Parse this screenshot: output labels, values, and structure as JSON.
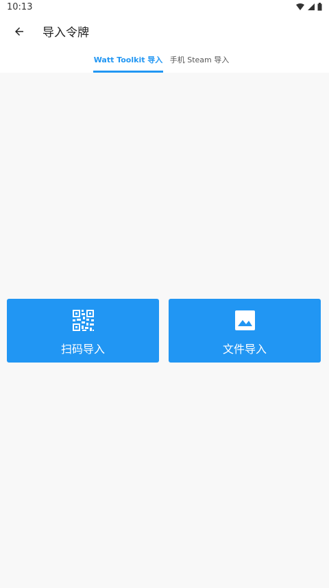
{
  "status": {
    "time": "10:13"
  },
  "appbar": {
    "title": "导入令牌"
  },
  "tabs": [
    {
      "label": "Watt Toolkit 导入"
    },
    {
      "label": "手机 Steam 导入"
    }
  ],
  "actions": {
    "scan_label": "扫码导入",
    "file_label": "文件导入"
  },
  "colors": {
    "accent": "#2196f3",
    "background": "#f8f8f8"
  }
}
